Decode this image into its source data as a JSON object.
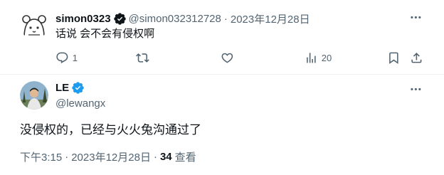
{
  "reply": {
    "name": "simon0323",
    "handle": "@simon032312728",
    "separator": "·",
    "date": "2023年12月28日",
    "text": "话说 会不会有侵权啊",
    "actions": {
      "reply_count": "1",
      "retweet_count": "",
      "like_count": "",
      "views_count": "20"
    }
  },
  "main": {
    "name": "LE",
    "handle": "@lewangx",
    "text": "没侵权的，已经与火火兔沟通过了",
    "time": "下午3:15",
    "separator": "·",
    "date": "2023年12月28日",
    "views_count": "34",
    "views_label": "查看"
  },
  "colors": {
    "verified_blue": "#1d9bf0",
    "secondary_text": "#536471",
    "primary_text": "#0f1419"
  }
}
